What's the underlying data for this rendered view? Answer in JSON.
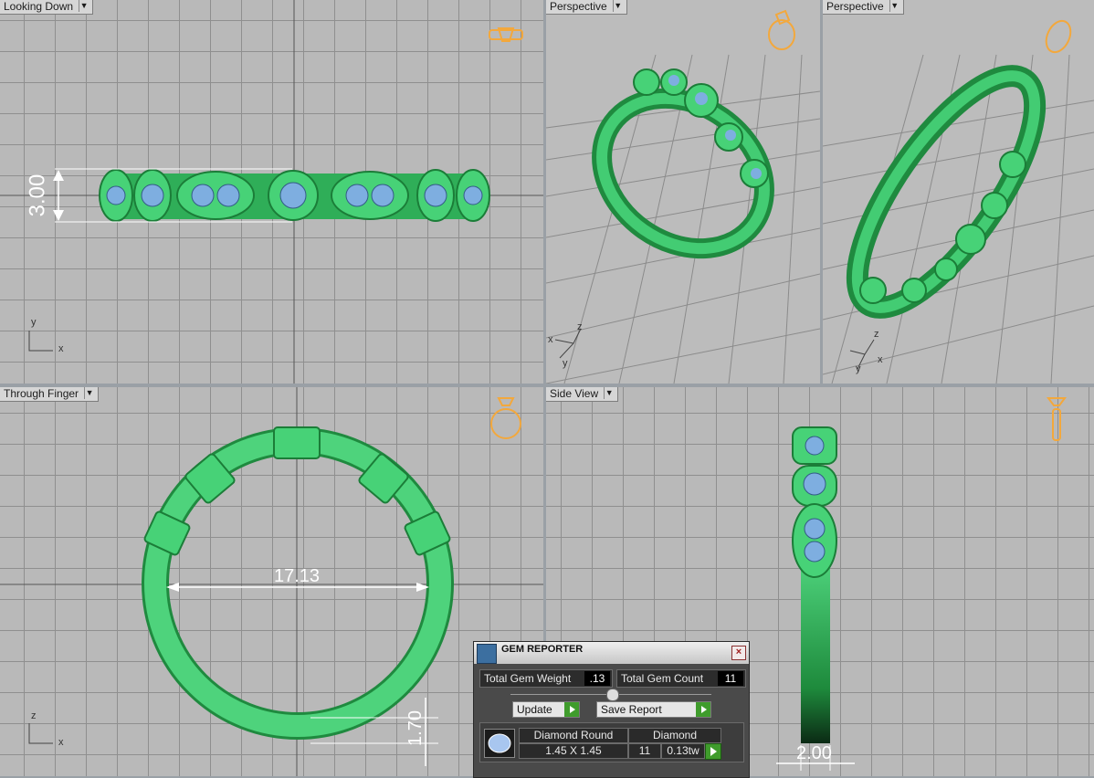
{
  "viewports": {
    "top_left": {
      "label": "Looking Down",
      "dimension": "3.00",
      "axes": [
        "y",
        "x"
      ]
    },
    "top_mid": {
      "label": "Perspective",
      "axes": [
        "z",
        "x",
        "y"
      ]
    },
    "top_right": {
      "label": "Perspective",
      "axes": [
        "z",
        "x",
        "y"
      ]
    },
    "bottom_left": {
      "label": "Through Finger",
      "dimension_diameter": "17.13",
      "dimension_thickness": "1.70",
      "axes": [
        "z",
        "x"
      ]
    },
    "bottom_right": {
      "label": "Side View",
      "dimension": "2.00"
    }
  },
  "gem_reporter": {
    "title": "GEM REPORTER",
    "total_weight_label": "Total Gem Weight",
    "total_weight_value": ".13",
    "total_count_label": "Total Gem Count",
    "total_count_value": "11",
    "update_label": "Update",
    "save_report_label": "Save Report",
    "gem": {
      "cut": "Diamond Round",
      "material": "Diamond",
      "size": "1.45 X 1.45",
      "count": "11",
      "weight": "0.13tw"
    }
  },
  "colors": {
    "ring": "#3ec76a",
    "ring_dark": "#1f8a3f",
    "gem": "#7eaee0",
    "gizmo": "#f3a83c"
  }
}
